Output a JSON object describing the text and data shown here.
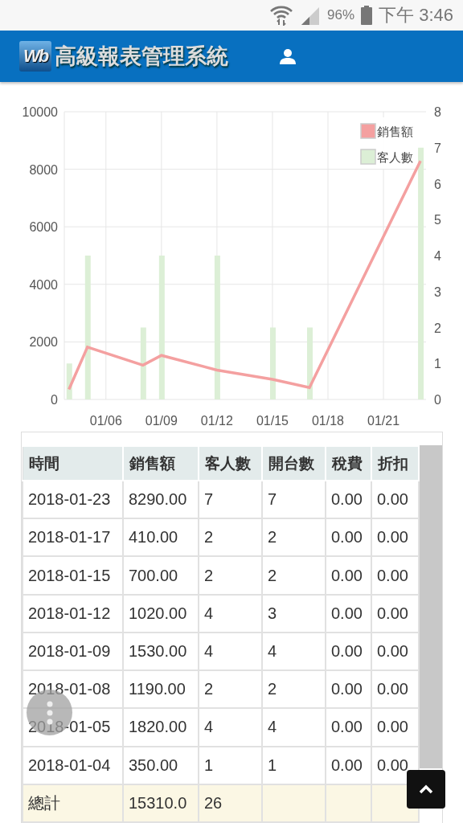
{
  "status_bar": {
    "battery": "96%",
    "time": "下午 3:46"
  },
  "header": {
    "logo": "Wb",
    "title": "高級報表管理系統"
  },
  "chart": {
    "chart_data": {
      "type": "bar",
      "categories": [
        null,
        null,
        "01/06",
        null,
        null,
        "01/09",
        null,
        null,
        "01/12",
        null,
        null,
        "01/15",
        null,
        null,
        "01/18",
        null,
        null,
        "01/21",
        null,
        null
      ],
      "series": [
        {
          "name": "銷售額",
          "color": "#f4a0a0",
          "type": "line",
          "values": [
            350,
            1820,
            null,
            null,
            1190,
            1530,
            null,
            null,
            1020,
            null,
            null,
            700,
            null,
            410,
            null,
            null,
            null,
            null,
            null,
            8290
          ]
        },
        {
          "name": "客人數",
          "color": "#dcefd6",
          "axis": "y2",
          "values": [
            1,
            4,
            null,
            null,
            2,
            4,
            null,
            null,
            4,
            null,
            null,
            2,
            null,
            2,
            null,
            null,
            null,
            null,
            null,
            7
          ]
        }
      ],
      "ylim": [
        0,
        10000
      ],
      "y2lim": [
        0,
        8
      ],
      "grid": true,
      "legend": "upper right",
      "yticks": [
        0,
        2000,
        4000,
        6000,
        8000,
        10000
      ],
      "y2ticks": [
        0,
        1,
        2,
        3,
        4,
        5,
        6,
        7,
        8
      ]
    }
  },
  "table": {
    "columns": [
      "時間",
      "銷售額",
      "客人數",
      "開台數",
      "稅費",
      "折扣"
    ],
    "rows": [
      [
        "2018-01-23",
        "8290.00",
        "7",
        "7",
        "0.00",
        "0.00"
      ],
      [
        "2018-01-17",
        "410.00",
        "2",
        "2",
        "0.00",
        "0.00"
      ],
      [
        "2018-01-15",
        "700.00",
        "2",
        "2",
        "0.00",
        "0.00"
      ],
      [
        "2018-01-12",
        "1020.00",
        "4",
        "3",
        "0.00",
        "0.00"
      ],
      [
        "2018-01-09",
        "1530.00",
        "4",
        "4",
        "0.00",
        "0.00"
      ],
      [
        "2018-01-08",
        "1190.00",
        "2",
        "2",
        "0.00",
        "0.00"
      ],
      [
        "2018-01-05",
        "1820.00",
        "4",
        "4",
        "0.00",
        "0.00"
      ],
      [
        "2018-01-04",
        "350.00",
        "1",
        "1",
        "0.00",
        "0.00"
      ]
    ],
    "total": [
      "總計",
      "15310.0",
      "26"
    ]
  }
}
